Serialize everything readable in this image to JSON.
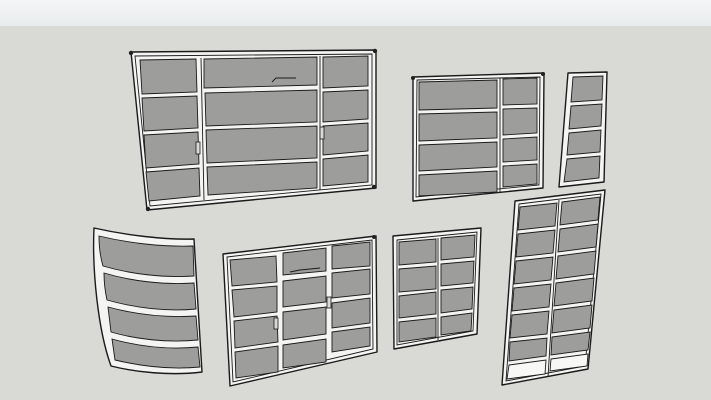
{
  "scene": {
    "background_top_color": "#eef1f3",
    "background_ground_color": "#d9d9d5",
    "frame_color": "#f4f4f2",
    "glass_color": "#9d9d9b",
    "line_color": "#1a1a1a"
  },
  "objects": [
    {
      "name": "large-three-section-window"
    },
    {
      "name": "two-section-window"
    },
    {
      "name": "narrow-single-window"
    },
    {
      "name": "curved-window"
    },
    {
      "name": "double-door-window"
    },
    {
      "name": "small-double-window"
    },
    {
      "name": "tall-double-door"
    }
  ]
}
